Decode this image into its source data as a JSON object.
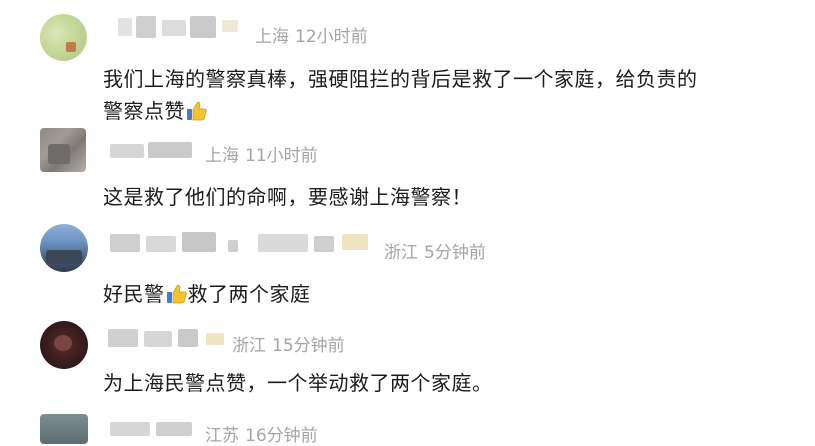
{
  "comments": [
    {
      "location": "上海",
      "time": "12小时前",
      "text_line1": "我们上海的警察真棒，强硬阻拦的背后是救了一个家庭，给负责的",
      "text_line2": "警察点赞",
      "has_emoji": true
    },
    {
      "location": "上海",
      "time": "11小时前",
      "text": "这是救了他们的命啊，要感谢上海警察！"
    },
    {
      "location": "浙江",
      "time": "5分钟前",
      "text_before": "好民警",
      "text_after": "救了两个家庭"
    },
    {
      "location": "浙江",
      "time": "15分钟前",
      "text": "为上海民警点赞，一个举动救了两个家庭。"
    },
    {
      "location": "江苏",
      "time": "16分钟前"
    }
  ],
  "emoji": "thumbs-up-icon"
}
